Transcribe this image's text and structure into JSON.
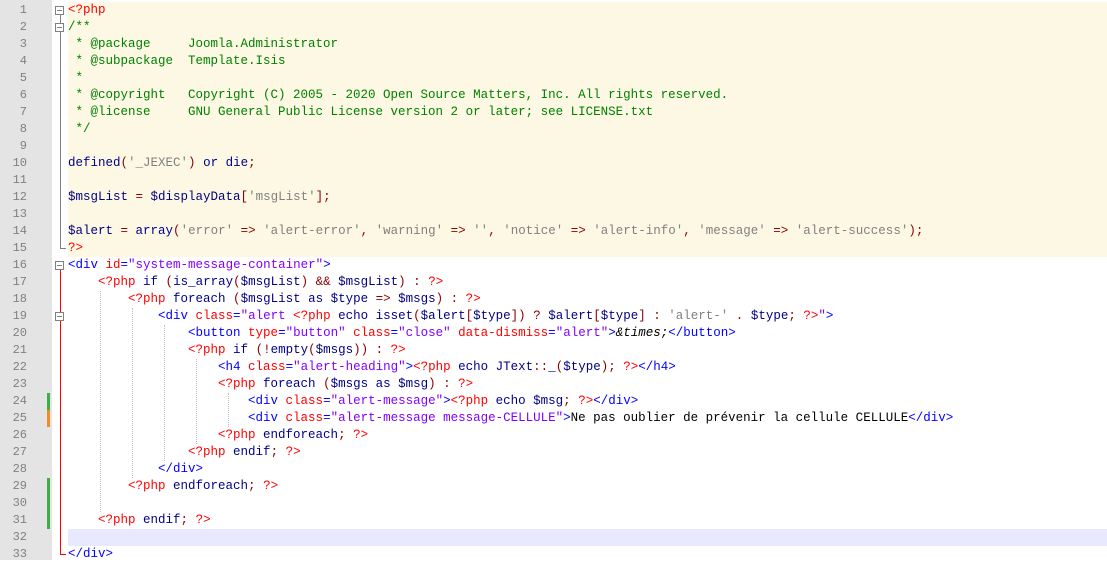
{
  "editor": {
    "lines": [
      {
        "n": "1",
        "tokens": [
          [
            "<?php",
            "delim"
          ]
        ]
      },
      {
        "n": "2",
        "tokens": [
          [
            "/**",
            "comment"
          ]
        ]
      },
      {
        "n": "3",
        "tokens": [
          [
            " * @package     Joomla.Administrator",
            "comment"
          ]
        ]
      },
      {
        "n": "4",
        "tokens": [
          [
            " * @subpackage  Template.Isis",
            "comment"
          ]
        ]
      },
      {
        "n": "5",
        "tokens": [
          [
            " *",
            "comment"
          ]
        ]
      },
      {
        "n": "6",
        "tokens": [
          [
            " * @copyright   Copyright (C) 2005 - 2020 Open Source Matters, Inc. All rights reserved.",
            "comment"
          ]
        ]
      },
      {
        "n": "7",
        "tokens": [
          [
            " * @license     GNU General Public License version 2 or later; see LICENSE.txt",
            "comment"
          ]
        ]
      },
      {
        "n": "8",
        "tokens": [
          [
            " */",
            "comment"
          ]
        ]
      },
      {
        "n": "9",
        "tokens": []
      },
      {
        "n": "10",
        "tokens": [
          [
            "defined",
            "kw"
          ],
          [
            "(",
            "op"
          ],
          [
            "'_JEXEC'",
            "str"
          ],
          [
            ")",
            "op"
          ],
          [
            " or die",
            "kw"
          ],
          [
            ";",
            "op"
          ]
        ]
      },
      {
        "n": "11",
        "tokens": []
      },
      {
        "n": "12",
        "tokens": [
          [
            "$msgList",
            "var"
          ],
          [
            " = ",
            "op"
          ],
          [
            "$displayData",
            "var"
          ],
          [
            "[",
            "op"
          ],
          [
            "'msgList'",
            "str"
          ],
          [
            "];",
            "op"
          ]
        ]
      },
      {
        "n": "13",
        "tokens": []
      },
      {
        "n": "14",
        "tokens": [
          [
            "$alert",
            "var"
          ],
          [
            " = ",
            "op"
          ],
          [
            "array",
            "kw"
          ],
          [
            "(",
            "op"
          ],
          [
            "'error'",
            "str"
          ],
          [
            " => ",
            "op"
          ],
          [
            "'alert-error'",
            "str"
          ],
          [
            ", ",
            "op"
          ],
          [
            "'warning'",
            "str"
          ],
          [
            " => ",
            "op"
          ],
          [
            "''",
            "str"
          ],
          [
            ", ",
            "op"
          ],
          [
            "'notice'",
            "str"
          ],
          [
            " => ",
            "op"
          ],
          [
            "'alert-info'",
            "str"
          ],
          [
            ", ",
            "op"
          ],
          [
            "'message'",
            "str"
          ],
          [
            " => ",
            "op"
          ],
          [
            "'alert-success'",
            "str"
          ],
          [
            ");",
            "op"
          ]
        ]
      },
      {
        "n": "15",
        "tokens": [
          [
            "?>",
            "delim"
          ]
        ]
      },
      {
        "n": "16",
        "tokens": [
          [
            "<div ",
            "tag"
          ],
          [
            "id",
            "attr"
          ],
          [
            "=",
            "tag"
          ],
          [
            "\"system-message-container\"",
            "val"
          ],
          [
            ">",
            "tag"
          ]
        ]
      },
      {
        "n": "17",
        "tokens": [
          [
            "    ",
            "plain"
          ],
          [
            "<?php",
            "delim"
          ],
          [
            " if ",
            "kw"
          ],
          [
            "(",
            "op"
          ],
          [
            "is_array",
            "kw"
          ],
          [
            "(",
            "op"
          ],
          [
            "$msgList",
            "var"
          ],
          [
            ")",
            "op"
          ],
          [
            " && ",
            "op"
          ],
          [
            "$msgList",
            "var"
          ],
          [
            ")",
            "op"
          ],
          [
            " : ",
            "op"
          ],
          [
            "?>",
            "delim"
          ]
        ]
      },
      {
        "n": "18",
        "tokens": [
          [
            "        ",
            "plain"
          ],
          [
            "<?php",
            "delim"
          ],
          [
            " foreach ",
            "kw"
          ],
          [
            "(",
            "op"
          ],
          [
            "$msgList",
            "var"
          ],
          [
            " as ",
            "kw"
          ],
          [
            "$type",
            "var"
          ],
          [
            " => ",
            "op"
          ],
          [
            "$msgs",
            "var"
          ],
          [
            ")",
            "op"
          ],
          [
            " : ",
            "op"
          ],
          [
            "?>",
            "delim"
          ]
        ]
      },
      {
        "n": "19",
        "tokens": [
          [
            "            ",
            "plain"
          ],
          [
            "<div ",
            "tag"
          ],
          [
            "class",
            "attr"
          ],
          [
            "=",
            "tag"
          ],
          [
            "\"alert ",
            "val"
          ],
          [
            "<?php",
            "delim"
          ],
          [
            " echo isset",
            "kw"
          ],
          [
            "(",
            "op"
          ],
          [
            "$alert",
            "var"
          ],
          [
            "[",
            "op"
          ],
          [
            "$type",
            "var"
          ],
          [
            "])",
            "op"
          ],
          [
            " ? ",
            "op"
          ],
          [
            "$alert",
            "var"
          ],
          [
            "[",
            "op"
          ],
          [
            "$type",
            "var"
          ],
          [
            "]",
            "op"
          ],
          [
            " : ",
            "op"
          ],
          [
            "'alert-'",
            "str"
          ],
          [
            " . ",
            "op"
          ],
          [
            "$type",
            "var"
          ],
          [
            ";",
            "op"
          ],
          [
            " ?>",
            "delim"
          ],
          [
            "\"",
            "val"
          ],
          [
            ">",
            "tag"
          ]
        ]
      },
      {
        "n": "20",
        "tokens": [
          [
            "                ",
            "plain"
          ],
          [
            "<button ",
            "tag"
          ],
          [
            "type",
            "attr"
          ],
          [
            "=",
            "tag"
          ],
          [
            "\"button\"",
            "val"
          ],
          [
            " class",
            "attr"
          ],
          [
            "=",
            "tag"
          ],
          [
            "\"close\"",
            "val"
          ],
          [
            " data-dismiss",
            "attr"
          ],
          [
            "=",
            "tag"
          ],
          [
            "\"alert\"",
            "val"
          ],
          [
            ">",
            "tag"
          ],
          [
            "&times;",
            "ent"
          ],
          [
            "</button>",
            "tag"
          ]
        ]
      },
      {
        "n": "21",
        "tokens": [
          [
            "                ",
            "plain"
          ],
          [
            "<?php",
            "delim"
          ],
          [
            " if ",
            "kw"
          ],
          [
            "(",
            "op"
          ],
          [
            "!",
            "op"
          ],
          [
            "empty",
            "kw"
          ],
          [
            "(",
            "op"
          ],
          [
            "$msgs",
            "var"
          ],
          [
            "))",
            "op"
          ],
          [
            " : ",
            "op"
          ],
          [
            "?>",
            "delim"
          ]
        ]
      },
      {
        "n": "22",
        "tokens": [
          [
            "                    ",
            "plain"
          ],
          [
            "<h4 ",
            "tag"
          ],
          [
            "class",
            "attr"
          ],
          [
            "=",
            "tag"
          ],
          [
            "\"alert-heading\"",
            "val"
          ],
          [
            ">",
            "tag"
          ],
          [
            "<?php",
            "delim"
          ],
          [
            " echo ",
            "kw"
          ],
          [
            "JText",
            "var"
          ],
          [
            "::",
            "op"
          ],
          [
            "_",
            "var"
          ],
          [
            "(",
            "op"
          ],
          [
            "$type",
            "var"
          ],
          [
            ");",
            "op"
          ],
          [
            " ?>",
            "delim"
          ],
          [
            "</h4>",
            "tag"
          ]
        ]
      },
      {
        "n": "23",
        "tokens": [
          [
            "                    ",
            "plain"
          ],
          [
            "<?php",
            "delim"
          ],
          [
            " foreach ",
            "kw"
          ],
          [
            "(",
            "op"
          ],
          [
            "$msgs",
            "var"
          ],
          [
            " as ",
            "kw"
          ],
          [
            "$msg",
            "var"
          ],
          [
            ")",
            "op"
          ],
          [
            " : ",
            "op"
          ],
          [
            "?>",
            "delim"
          ]
        ]
      },
      {
        "n": "24",
        "tokens": [
          [
            "                        ",
            "plain"
          ],
          [
            "<div ",
            "tag"
          ],
          [
            "class",
            "attr"
          ],
          [
            "=",
            "tag"
          ],
          [
            "\"alert-message\"",
            "val"
          ],
          [
            ">",
            "tag"
          ],
          [
            "<?php",
            "delim"
          ],
          [
            " echo ",
            "kw"
          ],
          [
            "$msg",
            "var"
          ],
          [
            ";",
            "op"
          ],
          [
            " ?>",
            "delim"
          ],
          [
            "</div>",
            "tag"
          ]
        ]
      },
      {
        "n": "25",
        "tokens": [
          [
            "                        ",
            "plain"
          ],
          [
            "<div ",
            "tag"
          ],
          [
            "class",
            "attr"
          ],
          [
            "=",
            "tag"
          ],
          [
            "\"alert-message message-CELLULE\"",
            "val"
          ],
          [
            ">",
            "tag"
          ],
          [
            "Ne pas oublier de prévenir la cellule CELLULE",
            "plain"
          ],
          [
            "</div>",
            "tag"
          ]
        ]
      },
      {
        "n": "26",
        "tokens": [
          [
            "                    ",
            "plain"
          ],
          [
            "<?php",
            "delim"
          ],
          [
            " endforeach",
            "kw"
          ],
          [
            ";",
            "op"
          ],
          [
            " ?>",
            "delim"
          ]
        ]
      },
      {
        "n": "27",
        "tokens": [
          [
            "                ",
            "plain"
          ],
          [
            "<?php",
            "delim"
          ],
          [
            " endif",
            "kw"
          ],
          [
            ";",
            "op"
          ],
          [
            " ?>",
            "delim"
          ]
        ]
      },
      {
        "n": "28",
        "tokens": [
          [
            "            ",
            "plain"
          ],
          [
            "</div>",
            "tag"
          ]
        ]
      },
      {
        "n": "29",
        "tokens": [
          [
            "        ",
            "plain"
          ],
          [
            "<?php",
            "delim"
          ],
          [
            " endforeach",
            "kw"
          ],
          [
            ";",
            "op"
          ],
          [
            " ?>",
            "delim"
          ]
        ]
      },
      {
        "n": "30",
        "tokens": []
      },
      {
        "n": "31",
        "tokens": [
          [
            "    ",
            "plain"
          ],
          [
            "<?php",
            "delim"
          ],
          [
            " endif",
            "kw"
          ],
          [
            ";",
            "op"
          ],
          [
            " ?>",
            "delim"
          ]
        ]
      },
      {
        "n": "32",
        "tokens": []
      },
      {
        "n": "33",
        "tokens": [
          [
            "</div>",
            "tag"
          ]
        ]
      }
    ],
    "php_block_lines": [
      "1",
      "2",
      "3",
      "4",
      "5",
      "6",
      "7",
      "8",
      "9",
      "10",
      "11",
      "12",
      "13",
      "14",
      "15"
    ],
    "current_line": "32",
    "change_markers": [
      {
        "line": "24",
        "color": "#3cb043"
      },
      {
        "line": "25",
        "color": "#f08c28"
      },
      {
        "line": "29",
        "color": "#3cb043"
      },
      {
        "line": "30",
        "color": "#3cb043"
      },
      {
        "line": "31",
        "color": "#3cb043"
      }
    ],
    "colors": {
      "gutter_bg": "#e4e4e4",
      "php_bg": "#fdf8e3",
      "current_line_bg": "#e8e8ff",
      "delimiter": "#ff0000",
      "keyword": "#00008b",
      "variable": "#000080",
      "string": "#808080",
      "tag": "#0000ff",
      "attribute": "#ff0000",
      "attribute_value": "#8000ff",
      "comment": "#008000"
    }
  }
}
